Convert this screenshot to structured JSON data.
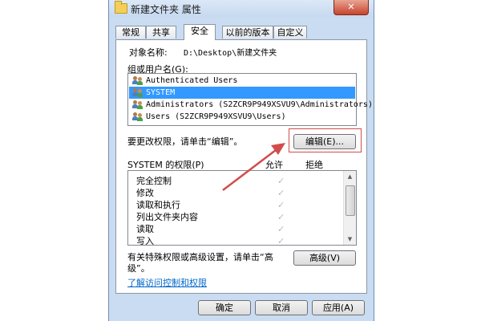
{
  "window": {
    "title": "新建文件夹 属性",
    "close_icon": "close-icon",
    "close_glyph": "✕"
  },
  "tabs": [
    {
      "label": "常规",
      "active": false
    },
    {
      "label": "共享",
      "active": false
    },
    {
      "label": "安全",
      "active": true
    },
    {
      "label": "以前的版本",
      "active": false
    },
    {
      "label": "自定义",
      "active": false
    }
  ],
  "security": {
    "object_name_label": "对象名称:",
    "object_name_value": "D:\\Desktop\\新建文件夹",
    "group_label": "组或用户名(G):",
    "users": [
      {
        "name": "Authenticated Users",
        "selected": false
      },
      {
        "name": "SYSTEM",
        "selected": true
      },
      {
        "name": "Administrators (S2ZCR9P949XSVU9\\Administrators)",
        "selected": false
      },
      {
        "name": "Users (S2ZCR9P949XSVU9\\Users)",
        "selected": false
      }
    ],
    "change_hint": "要更改权限，请单击“编辑”。",
    "edit_button": "编辑(E)...",
    "permissions_label": "SYSTEM 的权限(P)",
    "allow_header": "允许",
    "deny_header": "拒绝",
    "permissions": [
      {
        "name": "完全控制",
        "allow": true,
        "deny": false
      },
      {
        "name": "修改",
        "allow": true,
        "deny": false
      },
      {
        "name": "读取和执行",
        "allow": true,
        "deny": false
      },
      {
        "name": "列出文件夹内容",
        "allow": true,
        "deny": false
      },
      {
        "name": "读取",
        "allow": true,
        "deny": false
      },
      {
        "name": "写入",
        "allow": true,
        "deny": false
      }
    ],
    "advanced_hint_line1": "有关特殊权限或高级设置，请单击“高",
    "advanced_hint_line2": "级”。",
    "advanced_button": "高级(V)",
    "learn_link": "了解访问控制和权限"
  },
  "footer": {
    "ok_button": "确定",
    "cancel_button": "取消",
    "apply_button": "应用(A)"
  },
  "colors": {
    "selection": "#3399ff",
    "annotation_red": "#d24c4c",
    "link": "#0066cc"
  }
}
